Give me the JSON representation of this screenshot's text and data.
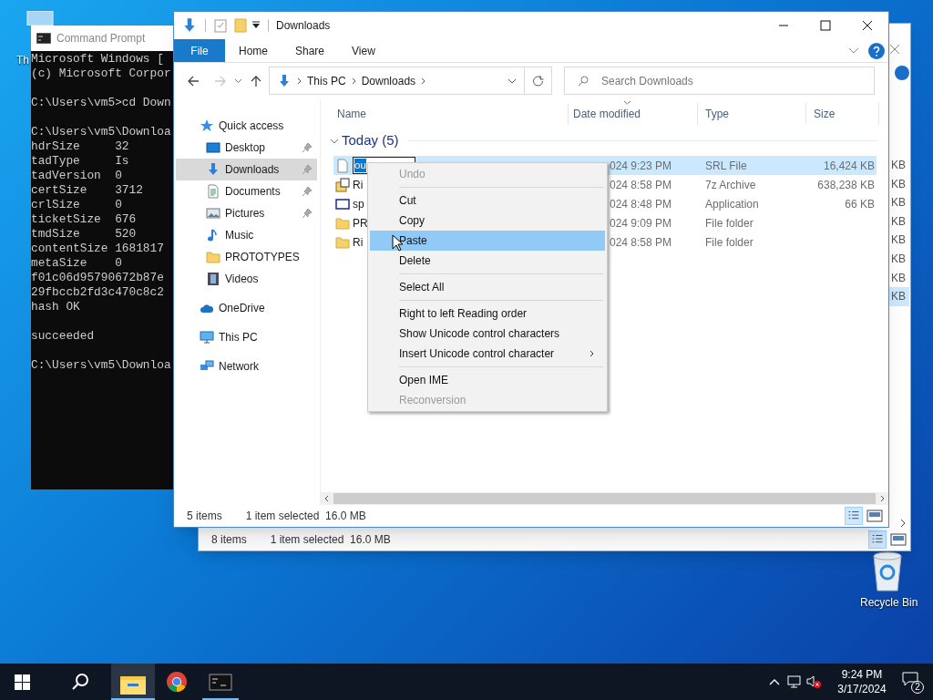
{
  "desktop": {
    "icons": [
      {
        "label": "Th",
        "kind": "shortcut"
      },
      {
        "label": "Recycle Bin",
        "kind": "recycle"
      }
    ]
  },
  "back_window": {
    "size_fragments": [
      {
        "text": "KB",
        "selected": false
      },
      {
        "text": "KB",
        "selected": false
      },
      {
        "text": "KB",
        "selected": false
      },
      {
        "text": "KB",
        "selected": false
      },
      {
        "text": "KB",
        "selected": false
      },
      {
        "text": "KB",
        "selected": false
      },
      {
        "text": "KB",
        "selected": false
      },
      {
        "text": "KB",
        "selected": true
      }
    ],
    "status": {
      "items": "8 items",
      "selection": "1 item selected  16.0 MB"
    }
  },
  "console": {
    "title": "Command Prompt",
    "blocks": [
      [
        "Microsoft Windows [",
        "(c) Microsoft Corpor"
      ],
      [
        "C:\\Users\\vm5>cd Down"
      ],
      [
        "C:\\Users\\vm5\\Downloa",
        "hdrSize     32",
        "tadType     Is",
        "tadVersion  0",
        "certSize    3712",
        "crlSize     0",
        "ticketSize  676",
        "tmdSize     520",
        "contentSize 1681817",
        "metaSize    0",
        "f01c06d95790672b87e",
        "29fbccb2fd3c470c8c2",
        "hash OK"
      ],
      [
        "succeeded"
      ],
      [
        "C:\\Users\\vm5\\Downloa"
      ]
    ]
  },
  "explorer": {
    "title": "Downloads",
    "ribbon_tabs": [
      {
        "label": "File",
        "kind": "file"
      },
      {
        "label": "Home",
        "kind": "tab"
      },
      {
        "label": "Share",
        "kind": "tab"
      },
      {
        "label": "View",
        "kind": "tab"
      }
    ],
    "address": {
      "crumbs": [
        "This PC",
        "Downloads"
      ]
    },
    "search": {
      "placeholder": "Search Downloads"
    },
    "nav": [
      {
        "label": "Quick access",
        "kind": "star",
        "selected": false,
        "pinned": false,
        "children": [
          {
            "label": "Desktop",
            "kind": "desktop",
            "selected": false,
            "pinned": true
          },
          {
            "label": "Downloads",
            "kind": "download",
            "selected": true,
            "pinned": true
          },
          {
            "label": "Documents",
            "kind": "document",
            "selected": false,
            "pinned": true
          },
          {
            "label": "Pictures",
            "kind": "picture",
            "selected": false,
            "pinned": true
          },
          {
            "label": "Music",
            "kind": "music",
            "selected": false,
            "pinned": false
          },
          {
            "label": "PROTOTYPES",
            "kind": "folder",
            "selected": false,
            "pinned": false
          },
          {
            "label": "Videos",
            "kind": "video",
            "selected": false,
            "pinned": false
          }
        ]
      },
      {
        "label": "OneDrive",
        "kind": "cloud",
        "selected": false,
        "pinned": false
      },
      {
        "label": "This PC",
        "kind": "pc",
        "selected": false,
        "pinned": false
      },
      {
        "label": "Network",
        "kind": "network",
        "selected": false,
        "pinned": false
      }
    ],
    "columns": [
      {
        "label": "Name",
        "sorted": false
      },
      {
        "label": "Date modified",
        "sorted": true
      },
      {
        "label": "Type",
        "sorted": false
      },
      {
        "label": "Size",
        "sorted": false
      }
    ],
    "group": {
      "label": "Today (5)",
      "expanded": true
    },
    "rows": [
      {
        "name": "ou",
        "kind": "file",
        "date": "024 9:23 PM",
        "type": "SRL File",
        "size": "16,424 KB",
        "selected": true,
        "renaming": true
      },
      {
        "name": "Ri",
        "kind": "archive",
        "date": "024 8:58 PM",
        "type": "7z Archive",
        "size": "638,238 KB",
        "selected": false,
        "renaming": false
      },
      {
        "name": "sp",
        "kind": "app",
        "date": "024 8:48 PM",
        "type": "Application",
        "size": "66 KB",
        "selected": false,
        "renaming": false
      },
      {
        "name": "PR",
        "kind": "folder",
        "date": "024 9:09 PM",
        "type": "File folder",
        "selected": false,
        "renaming": false
      },
      {
        "name": "Ri",
        "kind": "folder",
        "date": "024 8:58 PM",
        "type": "File folder",
        "selected": false,
        "renaming": false
      }
    ],
    "status": {
      "items": "5 items",
      "selection": "1 item selected  16.0 MB"
    }
  },
  "context_menu": {
    "groups": [
      [
        {
          "label": "Undo",
          "disabled": true,
          "selected": false
        }
      ],
      [
        {
          "label": "Cut",
          "disabled": false,
          "selected": false
        },
        {
          "label": "Copy",
          "disabled": false,
          "selected": false
        },
        {
          "label": "Paste",
          "disabled": false,
          "selected": true
        },
        {
          "label": "Delete",
          "disabled": false,
          "selected": false
        }
      ],
      [
        {
          "label": "Select All",
          "disabled": false,
          "selected": false
        }
      ],
      [
        {
          "label": "Right to left Reading order",
          "disabled": false,
          "selected": false
        },
        {
          "label": "Show Unicode control characters",
          "disabled": false,
          "selected": false
        },
        {
          "label": "Insert Unicode control character",
          "disabled": false,
          "selected": false,
          "submenu": true
        }
      ],
      [
        {
          "label": "Open IME",
          "disabled": false,
          "selected": false
        },
        {
          "label": "Reconversion",
          "disabled": true,
          "selected": false
        }
      ]
    ]
  },
  "taskbar": {
    "apps": [
      {
        "kind": "explorer",
        "active": true,
        "running": true
      },
      {
        "kind": "browser",
        "active": false,
        "running": false
      },
      {
        "kind": "terminal",
        "active": false,
        "running": true
      }
    ],
    "volume_muted": true,
    "time": "9:24 PM",
    "date": "3/17/2024",
    "notifications": "2"
  }
}
